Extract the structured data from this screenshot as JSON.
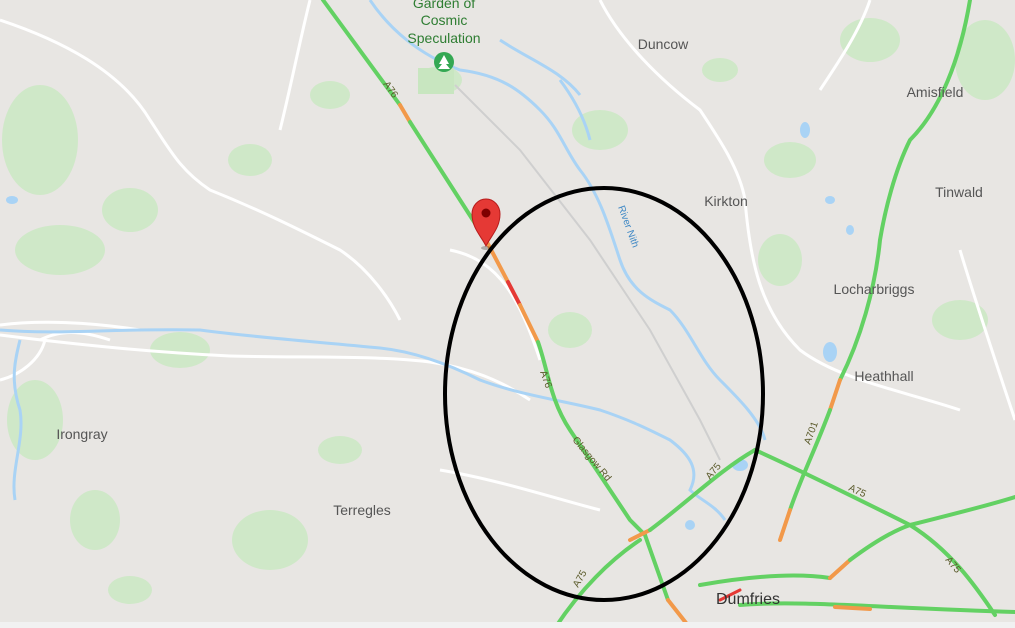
{
  "map": {
    "places": {
      "duncow": "Duncow",
      "amisfield": "Amisfield",
      "kirkton": "Kirkton",
      "tinwald": "Tinwald",
      "locharbriggs": "Locharbriggs",
      "heathhall": "Heathhall",
      "irongray": "Irongray",
      "terregles": "Terregles",
      "dumfries": "Dumfries"
    },
    "poi": {
      "line1": "Garden of",
      "line2": "Cosmic",
      "line3": "Speculation",
      "icon": "tree-icon"
    },
    "water": {
      "river_nith": "River Nith"
    },
    "roads": {
      "a76_north": "A76",
      "a76_south": "A76",
      "glasgow_rd": "Glasgow Rd",
      "a75_center": "A75",
      "a75_south": "A75",
      "a75_east": "A75",
      "a75_east2": "A75",
      "a701": "A701"
    },
    "marker": {
      "icon": "map-pin-icon",
      "color": "#e53935"
    },
    "colors": {
      "traffic_green": "#63d163",
      "traffic_orange": "#f2994a",
      "traffic_red": "#e53935",
      "water": "#a9d3f5",
      "park": "#c8e6c0",
      "annotation": "#000000"
    }
  }
}
